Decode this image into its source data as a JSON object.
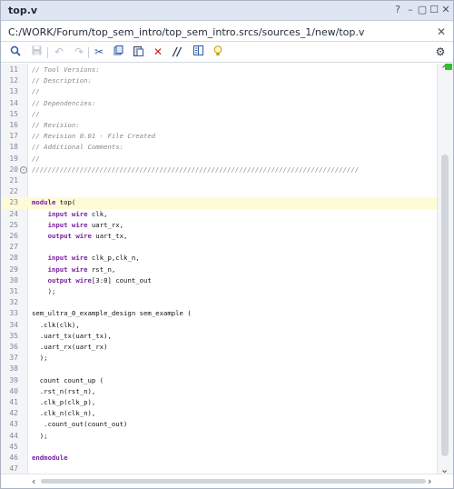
{
  "window": {
    "title": "top.v",
    "controls": {
      "help": "?",
      "minimize": "–",
      "restore": "▢",
      "maximize": "☐",
      "close": "✕"
    }
  },
  "path": {
    "text": "C:/WORK/Forum/top_sem_intro/top_sem_intro.srcs/sources_1/new/top.v",
    "close": "✕"
  },
  "toolbar": {
    "icons": [
      "search-icon",
      "save-icon",
      "undo-icon",
      "redo-icon",
      "cut-icon",
      "copy-icon",
      "paste-icon",
      "delete-icon",
      "comment-icon",
      "block-icon",
      "bulb-icon"
    ],
    "gear": "gear-icon"
  },
  "colors": {
    "keyword": "#7a1fa2",
    "comment": "#8a8a8a",
    "highlight": "#fffbd6"
  },
  "lines": [
    {
      "n": "11",
      "t": "// Tool Versions:",
      "c": true
    },
    {
      "n": "12",
      "t": "// Description:",
      "c": true
    },
    {
      "n": "13",
      "t": "//",
      "c": true
    },
    {
      "n": "14",
      "t": "// Dependencies:",
      "c": true
    },
    {
      "n": "15",
      "t": "//",
      "c": true
    },
    {
      "n": "16",
      "t": "// Revision:",
      "c": true
    },
    {
      "n": "17",
      "t": "// Revision 0.01 - File Created",
      "c": true
    },
    {
      "n": "18",
      "t": "// Additional Comments:",
      "c": true
    },
    {
      "n": "19",
      "t": "//",
      "c": true
    },
    {
      "n": "20",
      "t": "//////////////////////////////////////////////////////////////////////////////////",
      "c": true
    },
    {
      "n": "21",
      "t": ""
    },
    {
      "n": "22",
      "t": ""
    },
    {
      "n": "23",
      "pre": "",
      "kw": "module",
      "post": " top("
    },
    {
      "n": "24",
      "pre": "    ",
      "kw": "input wire",
      "post": " clk,"
    },
    {
      "n": "25",
      "pre": "    ",
      "kw": "input wire",
      "post": " uart_rx,"
    },
    {
      "n": "26",
      "pre": "    ",
      "kw": "output wire",
      "post": " uart_tx,"
    },
    {
      "n": "27",
      "t": ""
    },
    {
      "n": "28",
      "pre": "    ",
      "kw": "input wire",
      "post": " clk_p,clk_n,"
    },
    {
      "n": "29",
      "pre": "    ",
      "kw": "input wire",
      "post": " rst_n,"
    },
    {
      "n": "30",
      "pre": "    ",
      "kw": "output wire",
      "post": "[3:0] count_out"
    },
    {
      "n": "31",
      "t": "    );"
    },
    {
      "n": "32",
      "t": ""
    },
    {
      "n": "33",
      "t": "sem_ultra_0_example_design sem_example ("
    },
    {
      "n": "34",
      "t": "  .clk(clk),"
    },
    {
      "n": "35",
      "t": "  .uart_tx(uart_tx),"
    },
    {
      "n": "36",
      "t": "  .uart_rx(uart_rx)"
    },
    {
      "n": "37",
      "t": "  );"
    },
    {
      "n": "38",
      "t": ""
    },
    {
      "n": "39",
      "t": "  count count_up ("
    },
    {
      "n": "40",
      "t": "  .rst_n(rst_n),"
    },
    {
      "n": "41",
      "t": "  .clk_p(clk_p),"
    },
    {
      "n": "42",
      "t": "  .clk_n(clk_n),"
    },
    {
      "n": "43",
      "t": "   .count_out(count_out)"
    },
    {
      "n": "44",
      "t": "  );"
    },
    {
      "n": "45",
      "t": ""
    },
    {
      "n": "46",
      "pre": "",
      "kw": "endmodule",
      "post": ""
    },
    {
      "n": "47",
      "t": ""
    }
  ]
}
